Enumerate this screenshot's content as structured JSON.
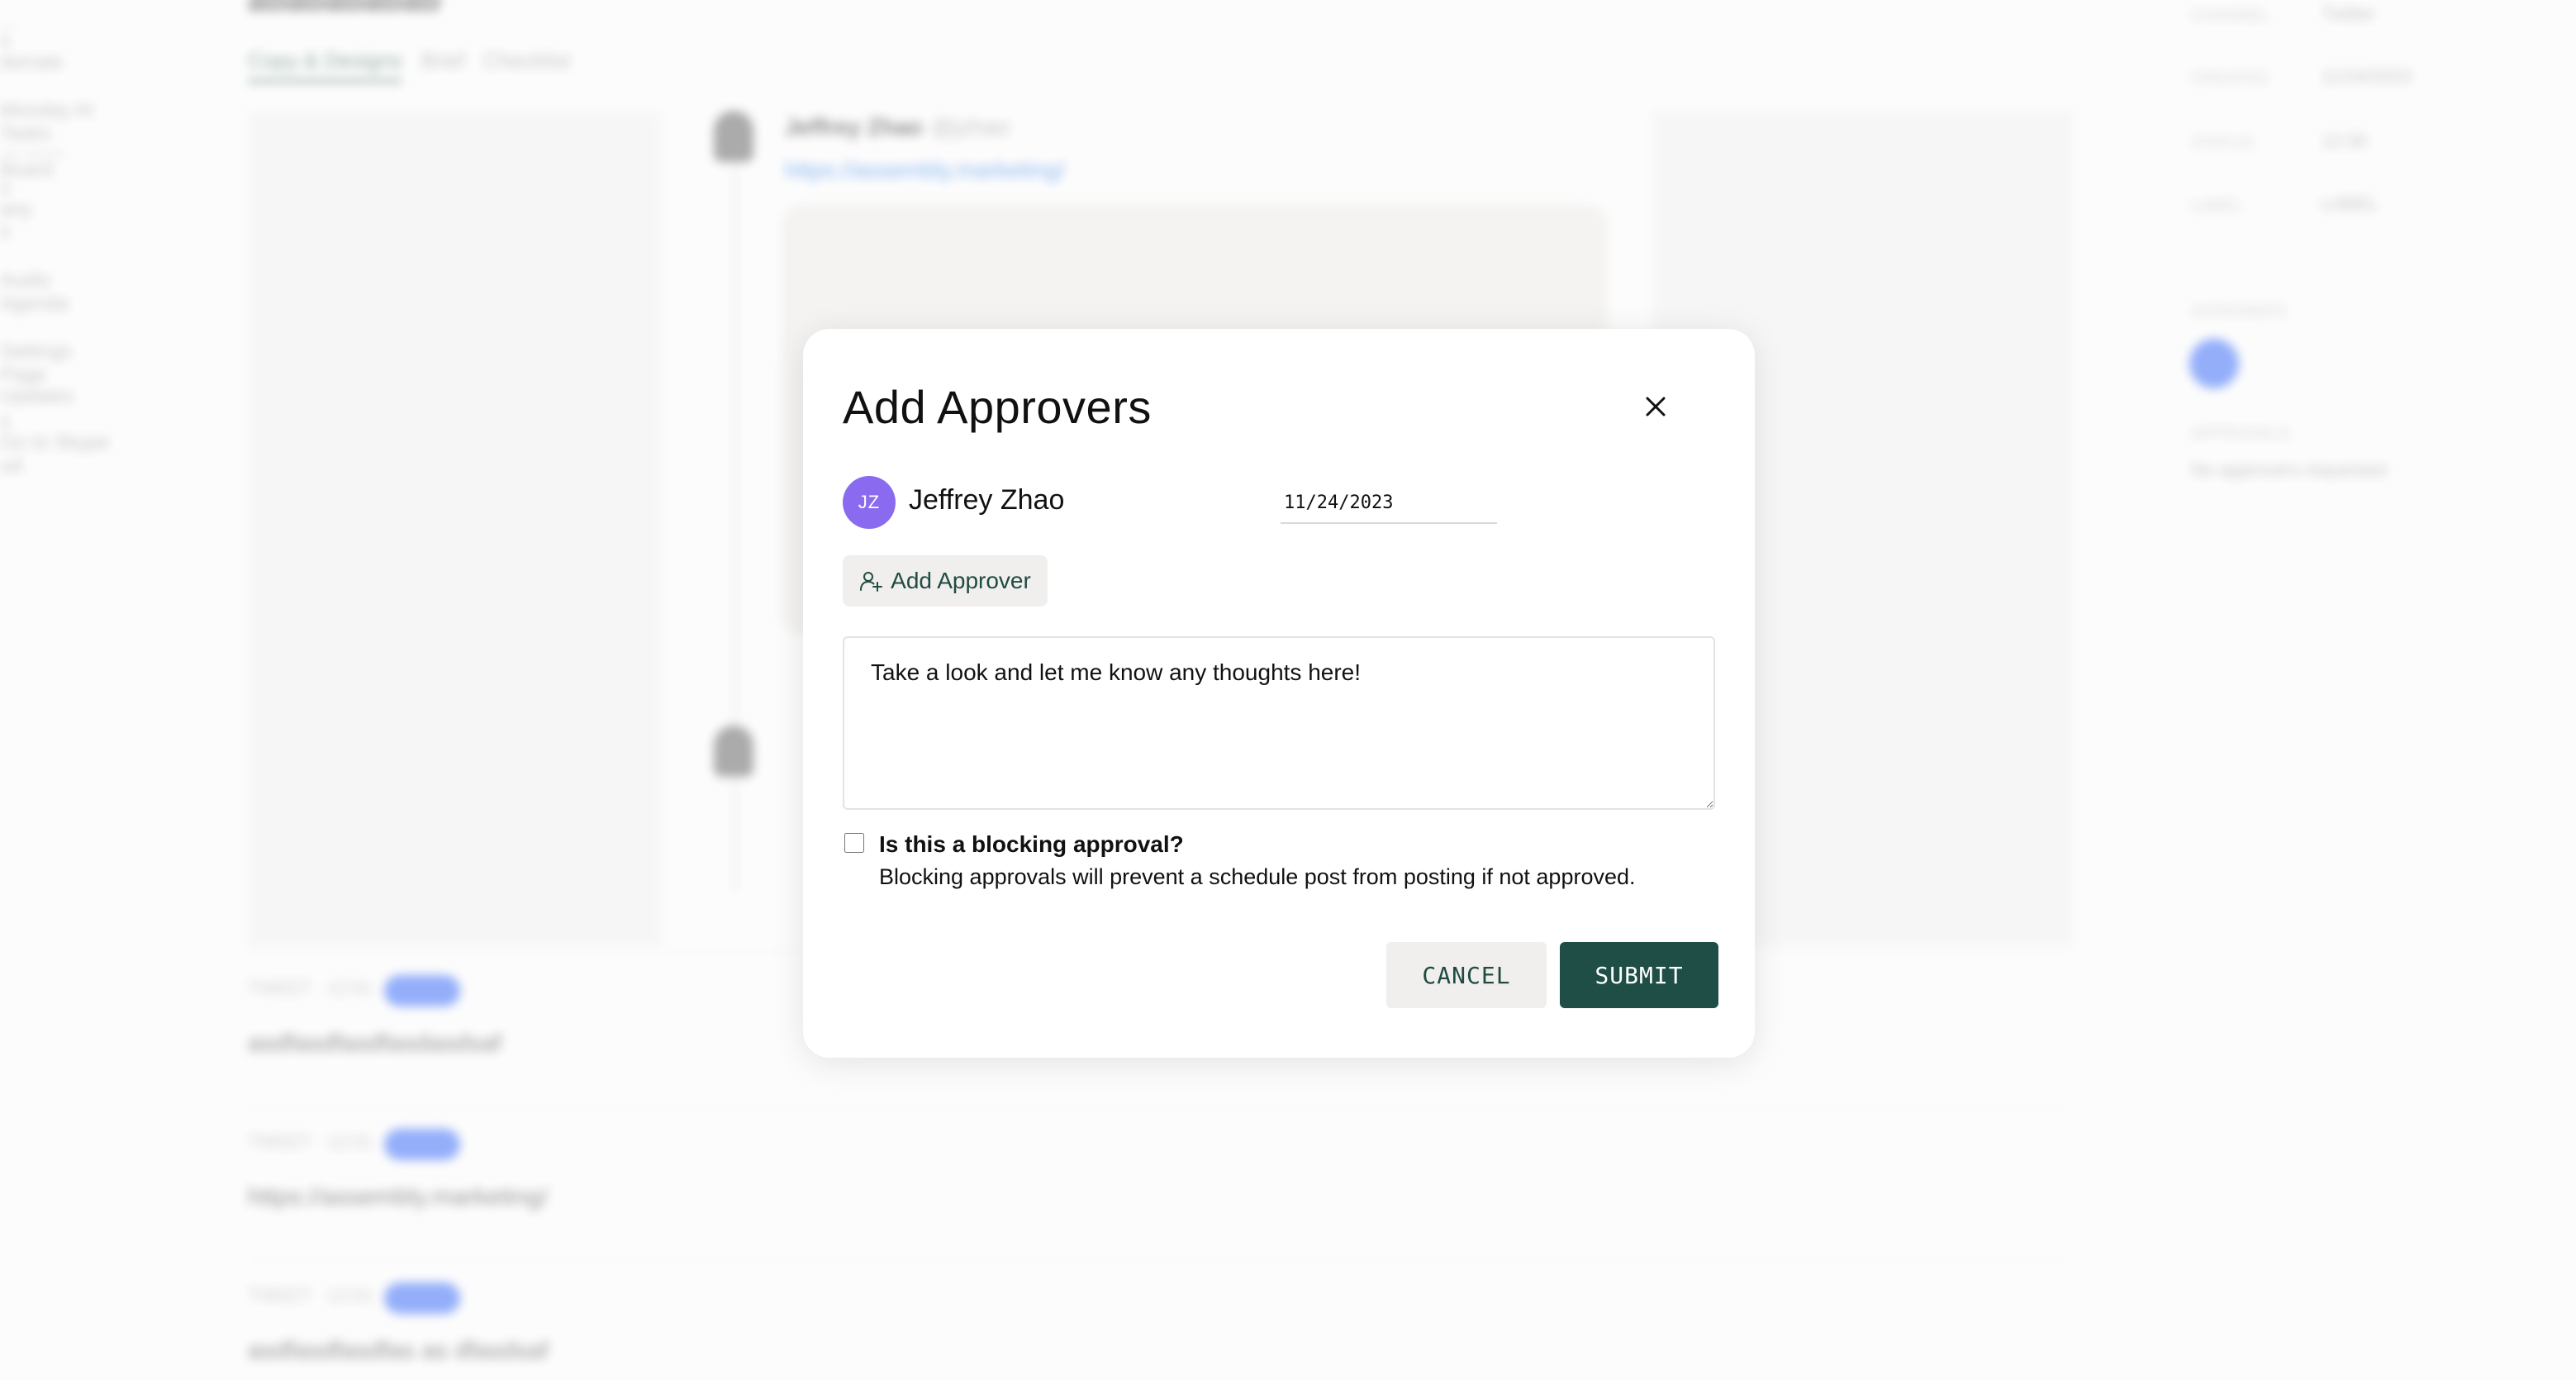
{
  "background": {
    "page_title": "ababababab",
    "tabs": [
      "Copy & Designs",
      "Brief",
      "Checklist"
    ],
    "sidebar_items": [
      "...",
      "s",
      "dorrate",
      "Monday AI",
      "Tasks",
      "— ——",
      "Board",
      "s",
      "any",
      "s",
      "Audio",
      "Agenda",
      "Settings",
      "Page",
      "Updates",
      "s",
      "Go to Skype",
      "ud"
    ],
    "post_author": "Jeffrey Zhao",
    "post_handle": "@jzhao",
    "post_link": "https://assembly.marketing/",
    "timeline_rows": [
      {
        "meta": "TWEET · 12:01",
        "text": "asdfasdfasdfasdasdsaf"
      },
      {
        "meta": "TWEET · 12:01",
        "text": "https://assembly.marketing/"
      },
      {
        "meta": "TWEET · 12:01",
        "text": "asdfasdfasdfas as dfasdsaf"
      }
    ],
    "right_panel": [
      {
        "key": "CHANNEL",
        "value": "Twitter"
      },
      {
        "key": "CREATED",
        "value": "11/24/2023"
      },
      {
        "key": "STATUS",
        "value": "12:30"
      },
      {
        "key": "LABEL",
        "value": "LABEL"
      },
      {
        "key": "ASSIGNEES",
        "value": ""
      },
      {
        "key": "APPROVALS",
        "value": "No approvers requested"
      }
    ]
  },
  "modal": {
    "title": "Add Approvers",
    "approver": {
      "initials": "JZ",
      "name": "Jeffrey Zhao",
      "avatar_color": "#8a6bf0"
    },
    "due_date": "11/24/2023",
    "add_approver_label": "Add Approver",
    "message_text": "Take a look and let me know any thoughts here!",
    "blocking": {
      "checked": false,
      "label": "Is this a blocking approval?",
      "help": "Blocking approvals will prevent a schedule post from posting if not approved."
    },
    "cancel_label": "CANCEL",
    "submit_label": "SUBMIT"
  },
  "colors": {
    "primary": "#1f4e47",
    "secondary_bg": "#f1efed",
    "avatar": "#8a6bf0"
  },
  "icons": {
    "close": "close-icon",
    "add_user": "user-plus-icon"
  }
}
